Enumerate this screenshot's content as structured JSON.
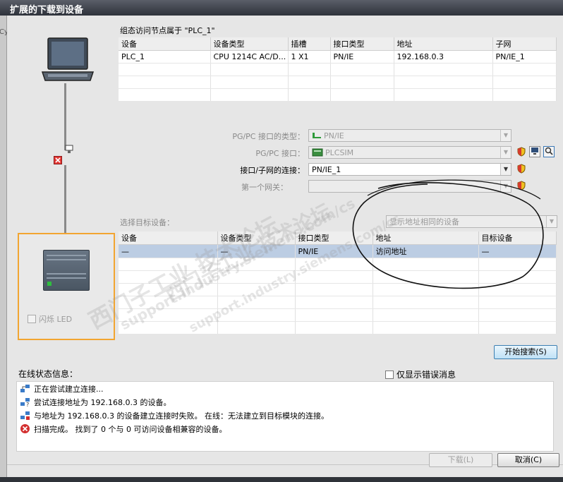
{
  "window": {
    "title": "扩展的下载到设备",
    "left_fragment": "Cy"
  },
  "header": {
    "configured_access": "组态访问节点属于 \"PLC_1\""
  },
  "config_table": {
    "columns": [
      "设备",
      "设备类型",
      "插槽",
      "接口类型",
      "地址",
      "子网"
    ],
    "rows": [
      [
        "PLC_1",
        "CPU 1214C AC/D...",
        "1 X1",
        "PN/IE",
        "192.168.0.3",
        "PN/IE_1"
      ]
    ]
  },
  "form": {
    "pgpc_type_label": "PG/PC 接口的类型：",
    "pgpc_type_value": "PN/IE",
    "pgpc_iface_label": "PG/PC 接口：",
    "pgpc_iface_value": "PLCSIM",
    "subnet_conn_label": "接口/子网的连接：",
    "subnet_conn_value": "PN/IE_1",
    "gateway_label": "第一个网关：",
    "gateway_value": ""
  },
  "target": {
    "label": "选择目标设备：",
    "filter_value": "显示地址相同的设备",
    "columns": [
      "设备",
      "设备类型",
      "接口类型",
      "地址",
      "目标设备"
    ],
    "rows": [
      [
        "—",
        "—",
        "PN/IE",
        "访问地址",
        "—"
      ]
    ]
  },
  "left_panel": {
    "flash_led_label": "闪烁 LED"
  },
  "buttons": {
    "start_search": "开始搜索(S)",
    "download": "下载(L)",
    "cancel": "取消(C)"
  },
  "status": {
    "title": "在线状态信息：",
    "only_errors": "仅显示错误消息",
    "messages": [
      "正在尝试建立连接...",
      "尝试连接地址为 192.168.0.3 的设备。",
      "与地址为 192.168.0.3 的设备建立连接时失败。 在线：无法建立到目标模块的连接。",
      "扫描完成。 找到了 0 个与 0 可访问设备相兼容的设备。"
    ]
  },
  "watermarks": [
    "西门子工业 技术论坛",
    "support.industry.siemens.com/cs",
    "西门子工业 技术论坛",
    "support.industry.siemens.com/cs"
  ],
  "colors": {
    "accent_orange": "#f2a531",
    "selected_row": "#bccde3",
    "error_red": "#d32f2f"
  }
}
